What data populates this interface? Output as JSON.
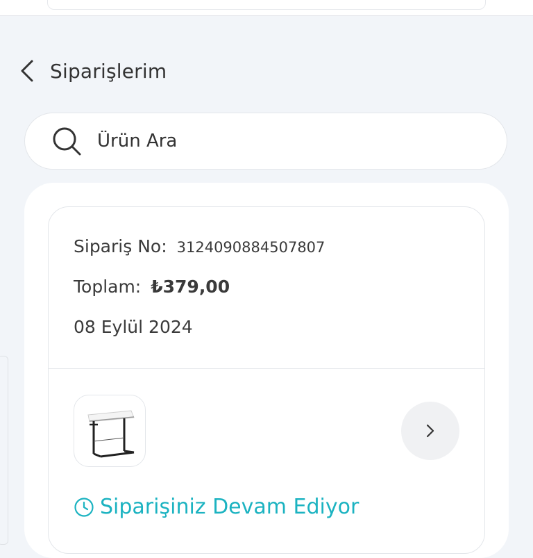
{
  "header": {
    "title": "Siparişlerim"
  },
  "search": {
    "placeholder": "Ürün Ara"
  },
  "order": {
    "number_label": "Sipariş No:",
    "number": "3124090884507807",
    "total_label": "Toplam:",
    "total": "₺379,00",
    "date": "08 Eylül 2024",
    "product_image": "side-table-product-image",
    "status": "Siparişiniz Devam Ediyor"
  },
  "colors": {
    "background": "#f2f5f9",
    "status_accent": "#1cb3c1",
    "text": "#333333"
  },
  "icons": {
    "back": "chevron-left-icon",
    "search": "search-icon",
    "detail": "chevron-right-icon",
    "status": "clock-icon"
  }
}
